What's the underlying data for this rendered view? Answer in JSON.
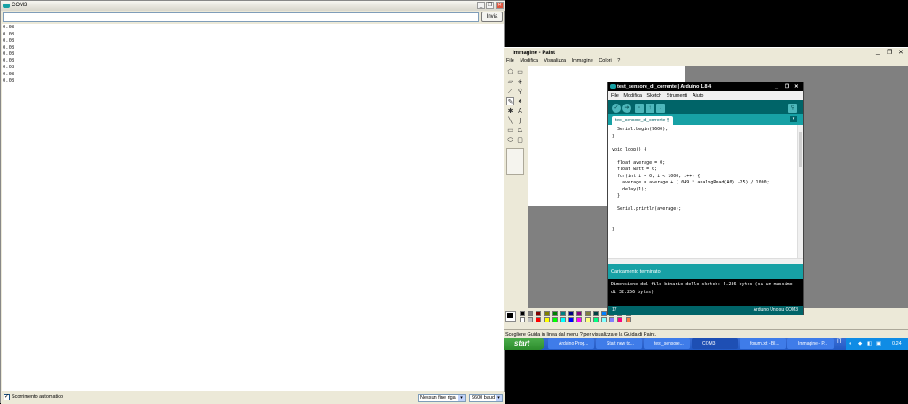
{
  "serial": {
    "title": "COM3",
    "send_label": "Invia",
    "output_lines": [
      "0.08",
      "0.08",
      "0.08",
      "0.08",
      "0.08",
      "0.08",
      "0.08",
      "0.08",
      "0.08"
    ],
    "autoscroll_label": "Scorrimento automatico",
    "autoscroll_checked": "✓",
    "line_ending": "Nessun fine riga",
    "baud": "9600 baud"
  },
  "paint": {
    "title": "Immagine - Paint",
    "menu": [
      "File",
      "Modifica",
      "Visualizza",
      "Immagine",
      "Colori",
      "?"
    ],
    "status": "Scegliere Guida in linea dal menu ? per visualizzare la Guida di Paint."
  },
  "ide": {
    "title": "test_sensore_di_corrente | Arduino 1.8.4",
    "menu": [
      "File",
      "Modifica",
      "Sketch",
      "Strumenti",
      "Aiuto"
    ],
    "tab": "test_sensore_di_corrente §",
    "code": "  Serial.begin(9600);\n}\n\nvoid loop() {\n\n  float average = 0;\n  float watt = 0;\n  for(int i = 0; i < 1000; i++) {\n    average = average + (.049 * analogRead(A0) -25) / 1000;\n    delay(1);\n  }\n\n  Serial.println(average);\n\n\n}",
    "status": "Caricamento terminato.",
    "console_1": "Dimensione del file binario dello sketch: 4.286 bytes (su un massimo",
    "console_2": "di 32.256 bytes)",
    "line_number": "17",
    "board": "Arduino Uno su COM3"
  },
  "taskbar": {
    "start": "start",
    "tasks": [
      "Arduino Prog...",
      "Start new to...",
      "test_sensore...",
      "COM3",
      "forum.txt - Bl...",
      "Immagine - P..."
    ],
    "clock": "0.24",
    "lang": "IT"
  }
}
